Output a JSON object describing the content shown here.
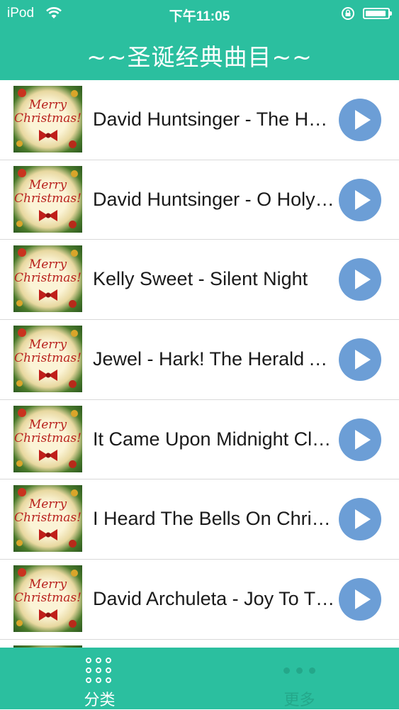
{
  "status_bar": {
    "carrier": "iPod",
    "time": "下午11:05"
  },
  "header": {
    "title": "~~圣诞经典曲目~~"
  },
  "songs": [
    {
      "title": "David Huntsinger - The Holy Night"
    },
    {
      "title": "David Huntsinger - O Holy Night"
    },
    {
      "title": "Kelly Sweet - Silent Night"
    },
    {
      "title": "Jewel - Hark! The Herald Angels Sing"
    },
    {
      "title": "It Came Upon Midnight Clear"
    },
    {
      "title": "I Heard The Bells On Christmas Day"
    },
    {
      "title": "David Archuleta - Joy To The World"
    }
  ],
  "thumbnail": {
    "text_line1": "Merry",
    "text_line2": "Christmas!"
  },
  "tabbar": {
    "tabs": [
      {
        "label": "分类",
        "icon": "grid-icon"
      },
      {
        "label": "更多",
        "icon": "more-icon"
      }
    ]
  },
  "colors": {
    "accent": "#2bbf9f",
    "play_button": "#6096d2"
  }
}
